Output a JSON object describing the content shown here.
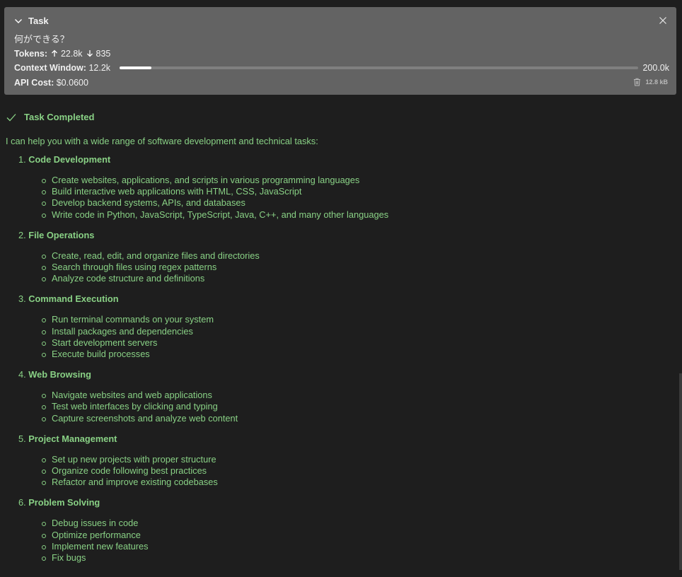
{
  "task": {
    "title": "Task",
    "question": "何ができる？",
    "tokens_label": "Tokens:",
    "tokens_in": "22.8k",
    "tokens_out": "835",
    "context_label": "Context Window:",
    "context_used": "12.2k",
    "context_max": "200.0k",
    "context_fraction": 0.061,
    "cost_label": "API Cost:",
    "cost_value": "$0.0600",
    "size": "12.8 kB"
  },
  "completed": {
    "label": "Task Completed",
    "intro": "I can help you with a wide range of software development and technical tasks:",
    "sections": [
      {
        "num": "1.",
        "name": "Code Development",
        "items": [
          "Create websites, applications, and scripts in various programming languages",
          "Build interactive web applications with HTML, CSS, JavaScript",
          "Develop backend systems, APIs, and databases",
          "Write code in Python, JavaScript, TypeScript, Java, C++, and many other languages"
        ]
      },
      {
        "num": "2.",
        "name": "File Operations",
        "items": [
          "Create, read, edit, and organize files and directories",
          "Search through files using regex patterns",
          "Analyze code structure and definitions"
        ]
      },
      {
        "num": "3.",
        "name": "Command Execution",
        "items": [
          "Run terminal commands on your system",
          "Install packages and dependencies",
          "Start development servers",
          "Execute build processes"
        ]
      },
      {
        "num": "4.",
        "name": "Web Browsing",
        "items": [
          "Navigate websites and web applications",
          "Test web interfaces by clicking and typing",
          "Capture screenshots and analyze web content"
        ]
      },
      {
        "num": "5.",
        "name": "Project Management",
        "items": [
          "Set up new projects with proper structure",
          "Organize code following best practices",
          "Refactor and improve existing codebases"
        ]
      },
      {
        "num": "6.",
        "name": "Problem Solving",
        "items": [
          "Debug issues in code",
          "Optimize performance",
          "Implement new features",
          "Fix bugs"
        ]
      }
    ]
  },
  "colors": {
    "accent_green": "#89d185",
    "card_bg": "#636363",
    "page_bg": "#1e1e1e"
  },
  "icons": {
    "collapse": "chevron-down-icon",
    "close": "close-icon",
    "tokens_in": "arrow-up-icon",
    "tokens_out": "arrow-down-icon",
    "delete": "trash-icon",
    "completed": "check-icon"
  }
}
